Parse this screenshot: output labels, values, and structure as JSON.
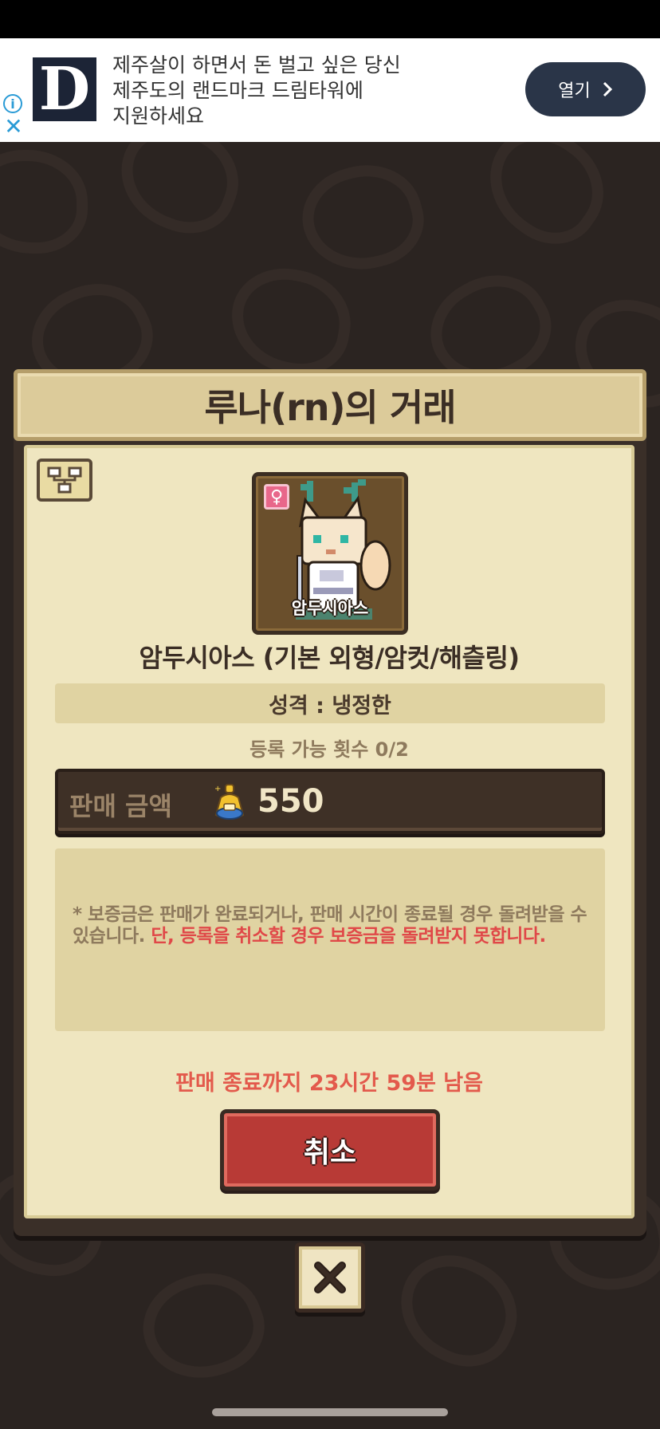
{
  "ad": {
    "logo_letter": "D",
    "text_line1": "제주살이 하면서 돈 벌고 싶은 당신",
    "text_line2": "제주도의 랜드마크 드림타워에",
    "text_line3": "지원하세요",
    "open_label": "열기"
  },
  "trade": {
    "title": "루나(rn)의 거래",
    "portrait_label": "암두시아스",
    "pet_name": "암두시아스 (기본 외형/암컷/해츨링)",
    "personality": "성격 : 냉정한",
    "registration_count": "등록 가능 횟수 0/2",
    "price_label": "판매 금액",
    "price_value": "550",
    "notice_normal": "* 보증금은 판매가 완료되거나, 판매 시간이 종료될 경우 돌려받을 수 있습니다. ",
    "notice_warning": "단, 등록을 취소할 경우 보증금을 돌려받지 못합니다.",
    "time_left": "판매 종료까지 23시간 59분 남음",
    "cancel_label": "취소"
  },
  "colors": {
    "background": "#2b2421",
    "panel": "#efe6c0",
    "cancel": "#b83a36",
    "warning": "#e04848"
  },
  "icons": {
    "gender": "female-icon",
    "tree": "family-tree-icon",
    "coin": "gold-pouch-icon",
    "close": "close-x-icon"
  }
}
